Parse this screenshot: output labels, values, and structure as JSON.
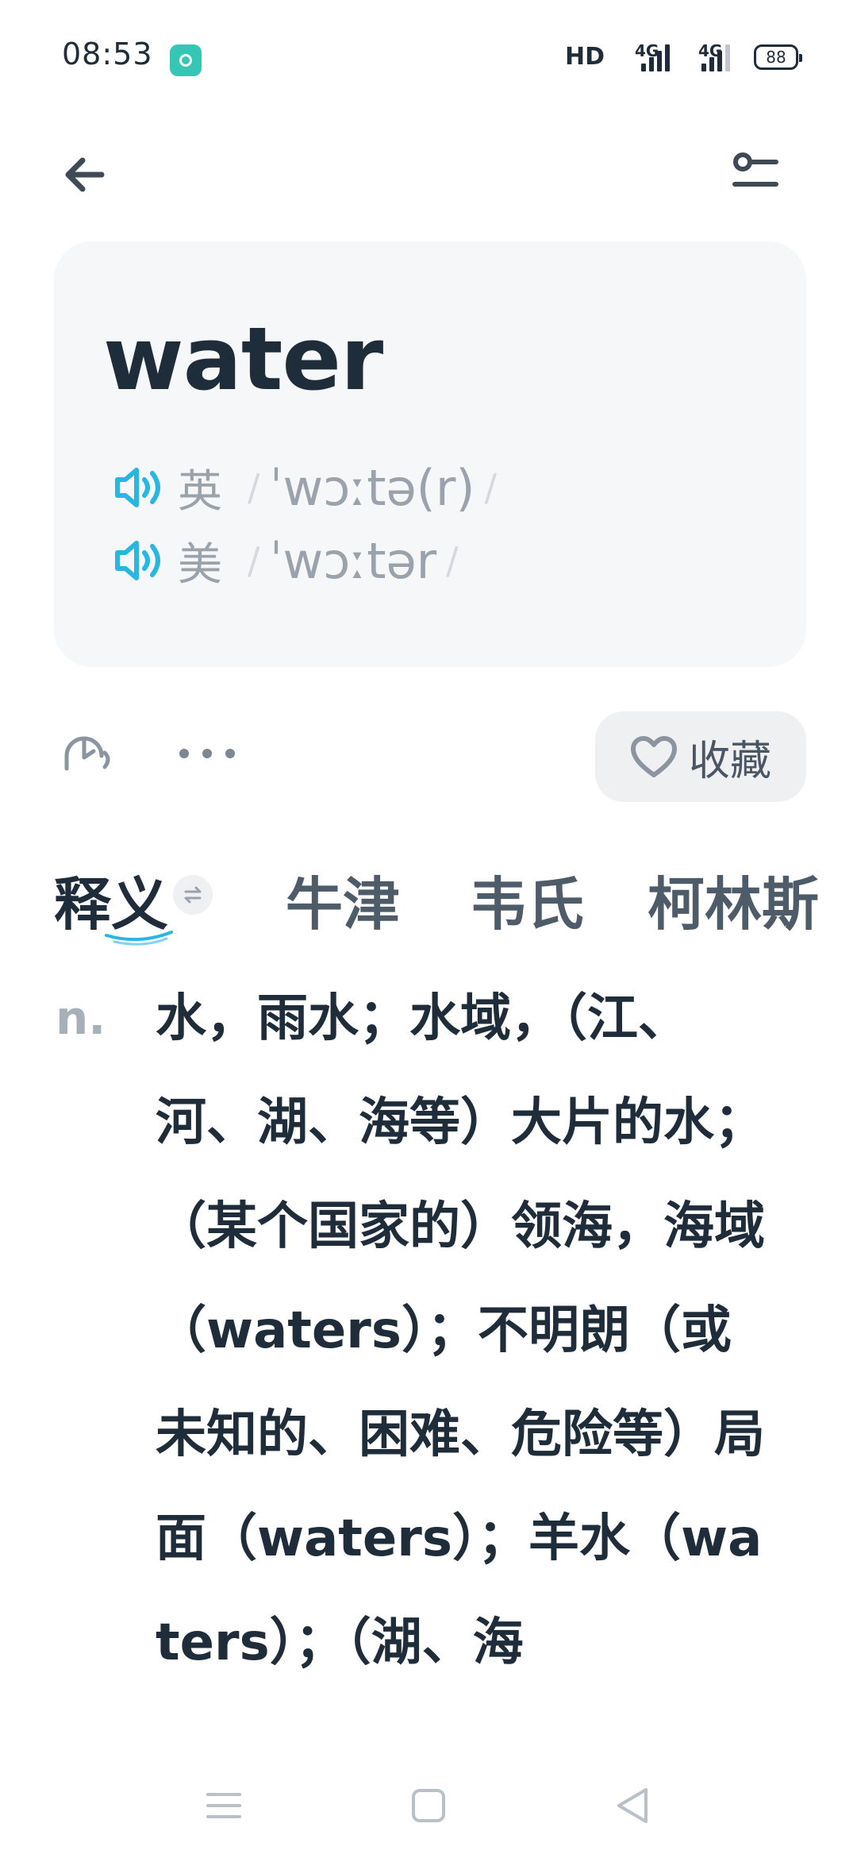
{
  "status_bar": {
    "time": "08:53",
    "network_1": "HD",
    "network_2": "4G",
    "network_3": "4G",
    "battery": "88"
  },
  "toolbar": {
    "back_icon": "arrow-left-icon",
    "filter_icon": "sliders-icon"
  },
  "word": {
    "headword": "water",
    "pronunciations": [
      {
        "region": "英",
        "ipa": "ˈwɔːtə(r)",
        "slash": "/"
      },
      {
        "region": "美",
        "ipa": "ˈwɔːtər",
        "slash": "/"
      }
    ]
  },
  "actions": {
    "collect_label": "收藏"
  },
  "tabs": [
    {
      "label": "释义",
      "active": true
    },
    {
      "label": "牛津",
      "active": false
    },
    {
      "label": "韦氏",
      "active": false
    },
    {
      "label": "柯林斯",
      "active": false
    }
  ],
  "definition": {
    "pos": "n.",
    "text": "水，雨水；水域，（江、河、湖、海等）大片的水；（某个国家的）领海，海域（waters）；不明朗（或未知的、困难、危险等）局面（waters）；羊水（waters）；（湖、海"
  },
  "colors": {
    "accent": "#28b7e0",
    "text": "#1f2d3a",
    "muted": "#9aa3ab",
    "card": "#f6f7f8"
  }
}
